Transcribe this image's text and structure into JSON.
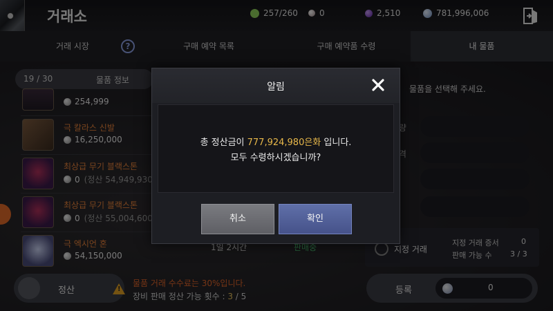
{
  "header": {
    "title": "거래소",
    "currencies": [
      {
        "icon": "energy-icon",
        "value": "257/260",
        "color": "#8fcf5a"
      },
      {
        "icon": "pearl-icon",
        "value": "0",
        "color": "#d8c8c8"
      },
      {
        "icon": "crystal-icon",
        "value": "2,510",
        "color": "#8a4ed0"
      },
      {
        "icon": "silver-icon",
        "value": "781,996,006",
        "color": "#a9c6ec"
      }
    ]
  },
  "tabs": [
    {
      "label": "거래 시장",
      "active": false
    },
    {
      "label": "구매 예약 목록",
      "active": false
    },
    {
      "label": "구매 예약품 수령",
      "active": false
    },
    {
      "label": "내 물품",
      "active": true
    }
  ],
  "list": {
    "page_count": "19 / 30",
    "title": "물품 정보",
    "items": [
      {
        "name": "",
        "price": "254,999",
        "settle": ""
      },
      {
        "name": "극 칼라스 신발",
        "price": "16,250,000",
        "settle": ""
      },
      {
        "name": "최상급 무기 블랙스톤",
        "price": "0",
        "settle": "(정산 54,949,930"
      },
      {
        "name": "최상급 무기 블랙스톤",
        "price": "0",
        "settle": "(정산 55,004,600"
      },
      {
        "name": "극 엑시언 혼",
        "price": "54,150,000",
        "settle": ""
      }
    ],
    "last_row": {
      "time": "1일 2시간",
      "status": "판매중"
    }
  },
  "right_panel": {
    "select_message": "물품을 선택해 주세요.",
    "designated_label": "지정 거래",
    "cert_label": "지정 거래 증서",
    "cert_value": "0",
    "sell_label": "판매 가능 수",
    "sell_value": "3 / 3"
  },
  "footer": {
    "settle_label": "정산",
    "fee_note": "물품 거래 수수료는 30%입니다.",
    "count_note_prefix": "장비 판매 정산 가능 횟수 : ",
    "count_value": "3",
    "count_suffix": " / 5",
    "register_label": "등록",
    "register_value": "0"
  },
  "modal": {
    "title": "알림",
    "message_prefix": "총 정산금이 ",
    "amount": "777,924,980은화",
    "message_suffix": " 입니다.",
    "message_line2": "모두 수령하시겠습니까?",
    "cancel_label": "취소",
    "confirm_label": "확인"
  }
}
